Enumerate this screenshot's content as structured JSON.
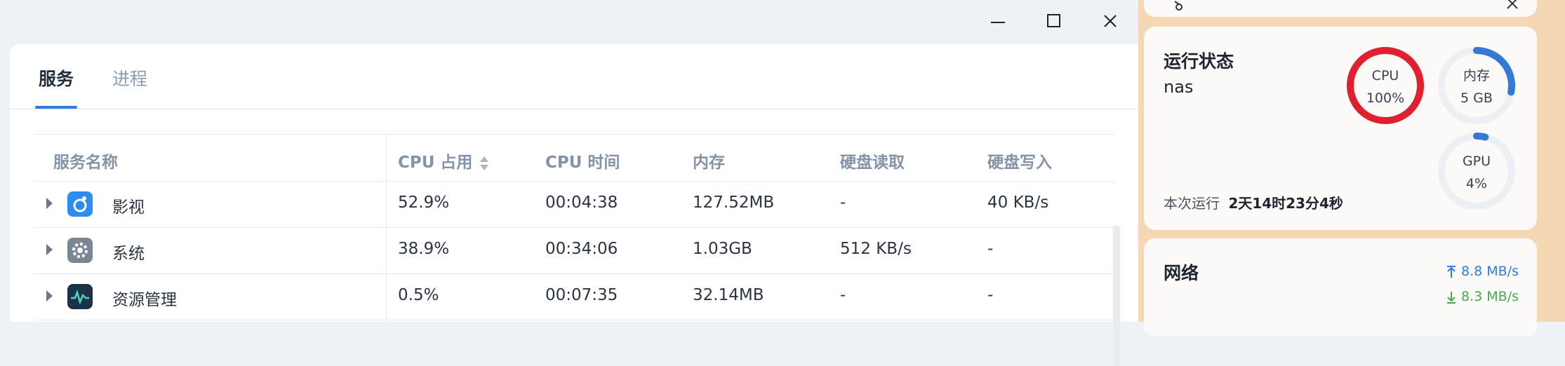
{
  "tabs": [
    {
      "label": "服务"
    },
    {
      "label": "进程"
    }
  ],
  "table": {
    "headers": {
      "name": "服务名称",
      "cpu": "CPU 占用",
      "cpu_time": "CPU 时间",
      "mem": "内存",
      "disk_read": "硬盘读取",
      "disk_write": "硬盘写入"
    },
    "rows": [
      {
        "name": "影视",
        "cpu": "52.9%",
        "cpu_time": "00:04:38",
        "mem": "127.52MB",
        "disk_read": "-",
        "disk_write": "40 KB/s",
        "icon": "video-app-icon"
      },
      {
        "name": "系统",
        "cpu": "38.9%",
        "cpu_time": "00:34:06",
        "mem": "1.03GB",
        "disk_read": "512 KB/s",
        "disk_write": "-",
        "icon": "gear-app-icon"
      },
      {
        "name": "资源管理",
        "cpu": "0.5%",
        "cpu_time": "00:07:35",
        "mem": "32.14MB",
        "disk_read": "-",
        "disk_write": "-",
        "icon": "monitor-app-icon"
      }
    ]
  },
  "status": {
    "title": "运行状态",
    "host": "nas",
    "cpu": {
      "label": "CPU",
      "value": "100%",
      "percent": 100,
      "color": "#e0202e"
    },
    "mem": {
      "label": "内存",
      "value": "5 GB",
      "percent": 28,
      "color": "#3478d8"
    },
    "gpu": {
      "label": "GPU",
      "value": "4%",
      "percent": 4,
      "color": "#3478d8"
    },
    "uptime_label": "本次运行",
    "uptime_value": "2天14时23分4秒"
  },
  "network": {
    "title": "网络",
    "upload": "8.8 MB/s",
    "download": "8.3 MB/s",
    "upload_color": "#2f7ae5",
    "download_color": "#4aa84e"
  }
}
